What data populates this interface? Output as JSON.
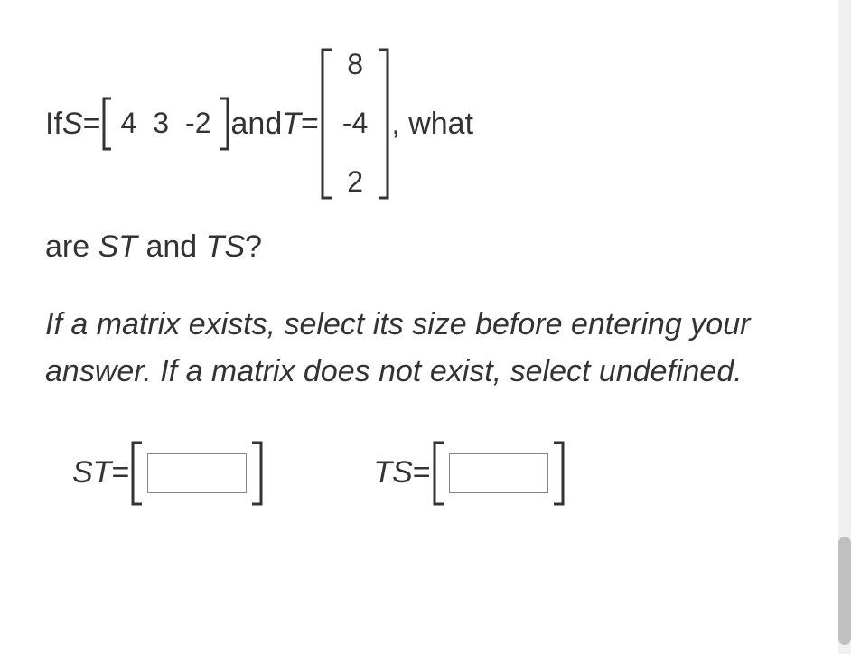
{
  "problem": {
    "text_if": "If ",
    "var_S": "S",
    "equals": " = ",
    "S_matrix": [
      "4",
      "3",
      "-2"
    ],
    "text_and": " and ",
    "var_T": "T",
    "T_matrix": [
      "8",
      "-4",
      "2"
    ],
    "text_what": ", what",
    "line2_are": "are ",
    "var_ST": "ST",
    "text_and2": " and ",
    "var_TS": "TS",
    "question_mark": "?"
  },
  "instruction": "If a matrix exists, select its size before entering your answer. If a matrix does not exist, select undefined.",
  "answers": {
    "st_label_var": "ST",
    "st_equals": " = ",
    "ts_label_var": "TS",
    "ts_equals": " = "
  }
}
